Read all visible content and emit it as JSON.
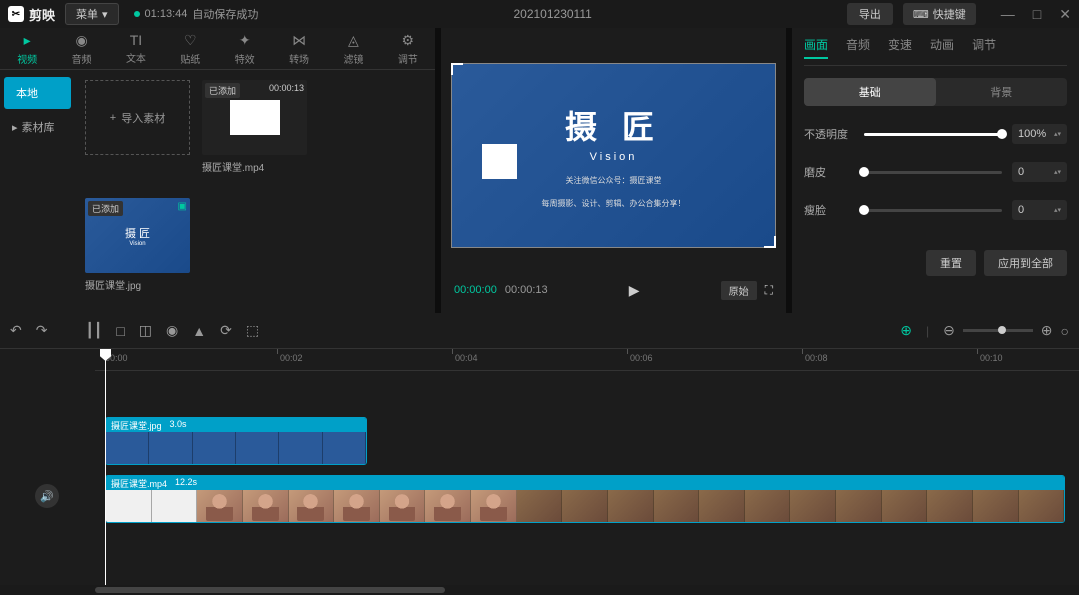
{
  "titlebar": {
    "app_name": "剪映",
    "menu": "菜单",
    "autosave_time": "01:13:44",
    "autosave_text": "自动保存成功",
    "project_name": "202101230111",
    "export": "导出",
    "shortcut": "快捷键"
  },
  "media_tabs": [
    {
      "label": "视频",
      "icon": "▸"
    },
    {
      "label": "音频",
      "icon": "◉"
    },
    {
      "label": "文本",
      "icon": "T"
    },
    {
      "label": "贴纸",
      "icon": "☺"
    },
    {
      "label": "特效",
      "icon": "✦"
    },
    {
      "label": "转场",
      "icon": "⋈"
    },
    {
      "label": "滤镜",
      "icon": "◬"
    },
    {
      "label": "调节",
      "icon": "⚙"
    }
  ],
  "sidebar": {
    "local": "本地",
    "library": "素材库"
  },
  "import_label": "导入素材",
  "media_items": [
    {
      "name": "摄匠课堂.mp4",
      "badge": "已添加",
      "duration": "00:00:13",
      "type": "video"
    },
    {
      "name": "摄匠课堂.jpg",
      "badge": "已添加",
      "type": "image"
    }
  ],
  "preview": {
    "logo_text": "摄 匠",
    "sub_text": "Vision",
    "line1": "关注微信公众号：摄匠课堂",
    "line2": "每周摄影、设计、剪辑、办公合集分享！",
    "current": "00:00:00",
    "total": "00:00:13",
    "ratio": "原始"
  },
  "props": {
    "tabs": [
      "画面",
      "音频",
      "变速",
      "动画",
      "调节"
    ],
    "sub_tabs": [
      "基础",
      "背景"
    ],
    "opacity_label": "不透明度",
    "opacity_value": "100%",
    "smooth_label": "磨皮",
    "smooth_value": "0",
    "face_label": "瘦脸",
    "face_value": "0",
    "reset": "重置",
    "apply_all": "应用到全部"
  },
  "ruler": [
    "00:00",
    "00:02",
    "00:04",
    "00:06",
    "00:08",
    "00:10"
  ],
  "clips": [
    {
      "name": "摄匠课堂.jpg",
      "duration": "3.0s"
    },
    {
      "name": "摄匠课堂.mp4",
      "duration": "12.2s"
    }
  ]
}
